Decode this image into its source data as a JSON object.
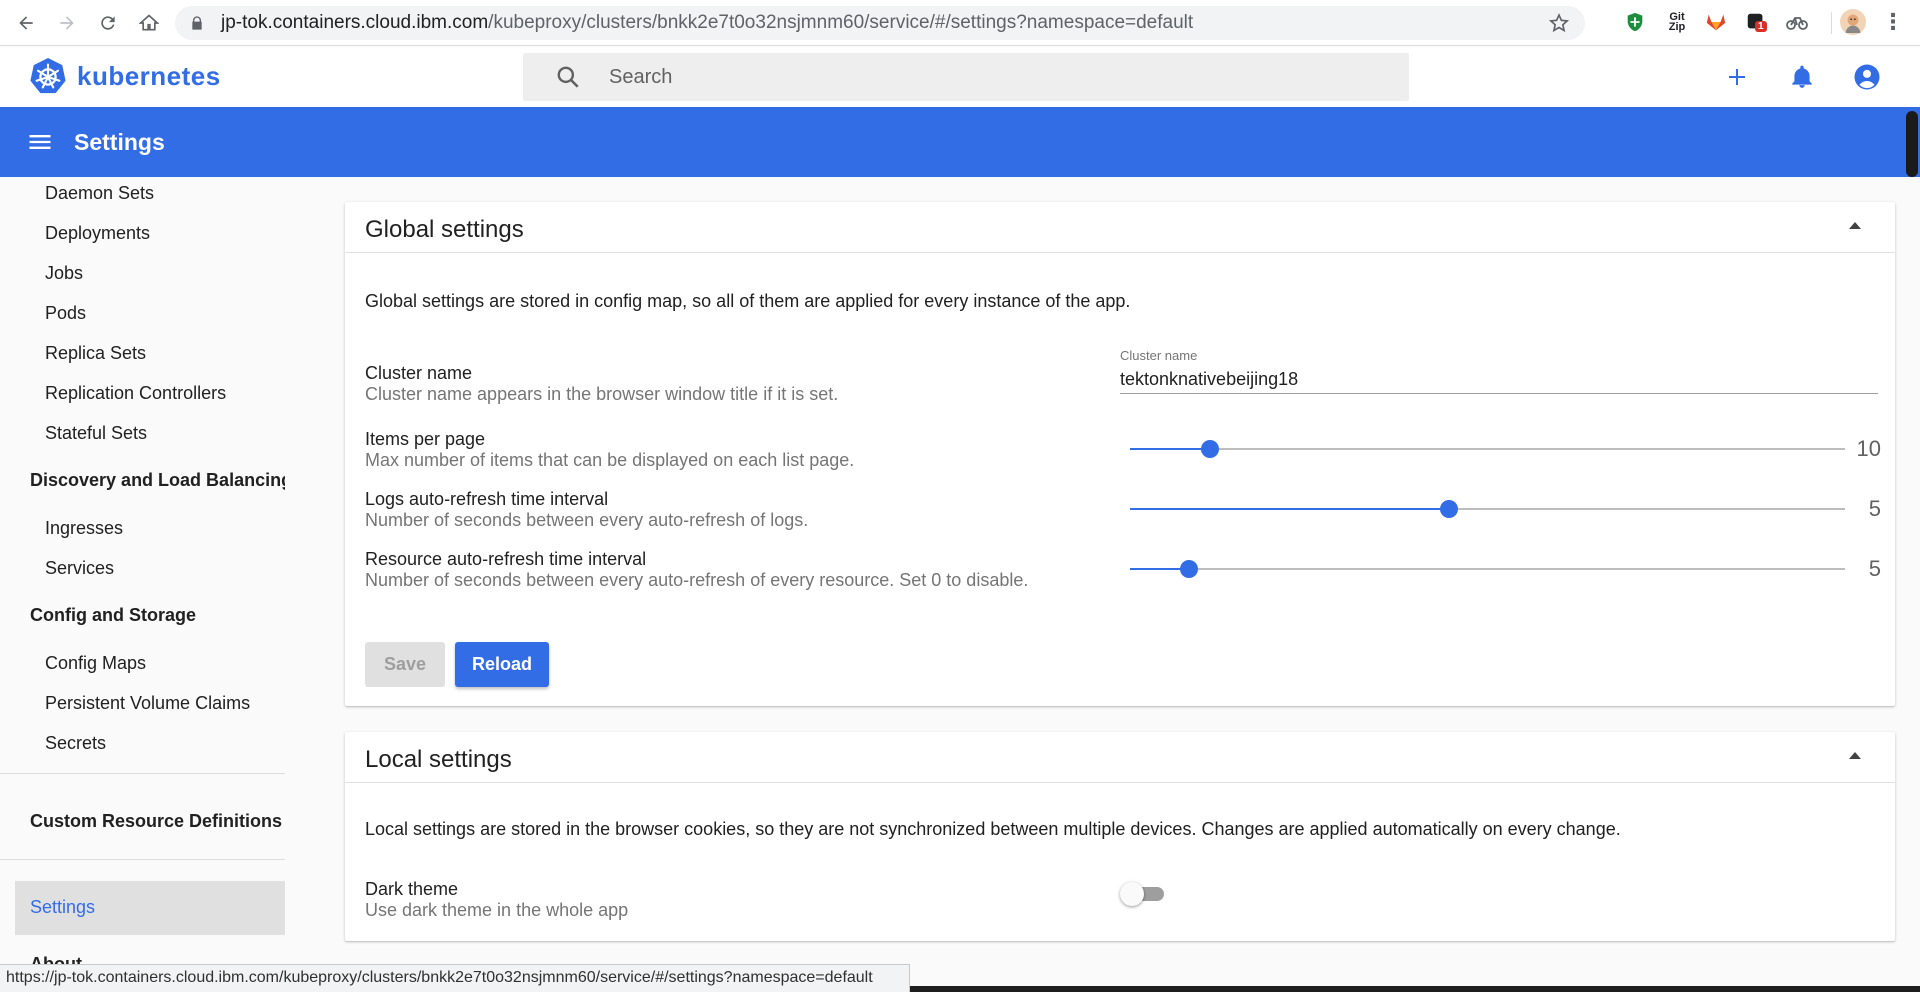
{
  "browser": {
    "url_host": "jp-tok.containers.cloud.ibm.com",
    "url_path": "/kubeproxy/clusters/bnkk2e7t0o32nsjmnm60/service/#/settings?namespace=default",
    "status_url": "https://jp-tok.containers.cloud.ibm.com/kubeproxy/clusters/bnkk2e7t0o32nsjmnm60/service/#/settings?namespace=default",
    "extensions": [
      {
        "name": "shield-extension-icon",
        "glyph": "✚",
        "color": "#1e8e3e"
      },
      {
        "name": "gitzip-extension-icon",
        "glyph": "Git Zip",
        "color": "#202124"
      },
      {
        "name": "gitlab-extension-icon",
        "glyph": "◆",
        "color": "#e24329"
      },
      {
        "name": "notification-extension-icon",
        "glyph": "1",
        "color": "#d93025"
      },
      {
        "name": "bike-extension-icon",
        "glyph": "⚲",
        "color": "#5f6368"
      }
    ]
  },
  "header": {
    "logo_text": "kubernetes",
    "search_placeholder": "Search"
  },
  "toolbar": {
    "title": "Settings"
  },
  "sidebar": {
    "items": [
      {
        "label": "Daemon Sets",
        "type": "item"
      },
      {
        "label": "Deployments",
        "type": "item"
      },
      {
        "label": "Jobs",
        "type": "item"
      },
      {
        "label": "Pods",
        "type": "item"
      },
      {
        "label": "Replica Sets",
        "type": "item"
      },
      {
        "label": "Replication Controllers",
        "type": "item"
      },
      {
        "label": "Stateful Sets",
        "type": "item"
      },
      {
        "label": "Discovery and Load Balancing",
        "type": "category"
      },
      {
        "label": "Ingresses",
        "type": "item"
      },
      {
        "label": "Services",
        "type": "item"
      },
      {
        "label": "Config and Storage",
        "type": "category"
      },
      {
        "label": "Config Maps",
        "type": "item"
      },
      {
        "label": "Persistent Volume Claims",
        "type": "item"
      },
      {
        "label": "Secrets",
        "type": "item"
      },
      {
        "label": "Custom Resource Definitions",
        "type": "category"
      },
      {
        "label": "Settings",
        "type": "active"
      },
      {
        "label": "About",
        "type": "category"
      }
    ]
  },
  "global": {
    "title": "Global settings",
    "description": "Global settings are stored in config map, so all of them are applied for every instance of the app.",
    "cluster_name": {
      "label": "Cluster name",
      "sub": "Cluster name appears in the browser window title if it is set.",
      "field_label": "Cluster name",
      "value": "tektonknativebeijing18"
    },
    "items_per_page": {
      "label": "Items per page",
      "sub": "Max number of items that can be displayed on each list page.",
      "value": "10",
      "fraction": 0.112
    },
    "logs_refresh": {
      "label": "Logs auto-refresh time interval",
      "sub": "Number of seconds between every auto-refresh of logs.",
      "value": "5",
      "fraction": 0.446
    },
    "resource_refresh": {
      "label": "Resource auto-refresh time interval",
      "sub": "Number of seconds between every auto-refresh of every resource. Set 0 to disable.",
      "value": "5",
      "fraction": 0.083
    },
    "save_label": "Save",
    "reload_label": "Reload"
  },
  "local": {
    "title": "Local settings",
    "description": "Local settings are stored in the browser cookies, so they are not synchronized between multiple devices. Changes are applied automatically on every change.",
    "dark_theme": {
      "label": "Dark theme",
      "sub": "Use dark theme in the whole app",
      "enabled": false
    }
  },
  "colors": {
    "accent": "#326de6"
  }
}
